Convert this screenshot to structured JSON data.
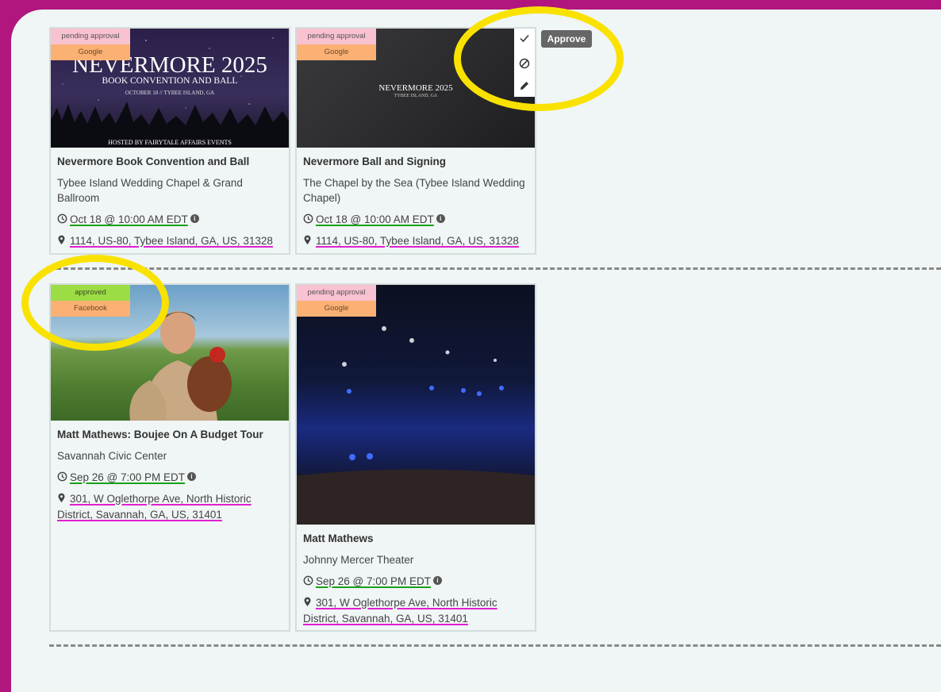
{
  "cards": [
    {
      "status": "pending approval",
      "source": "Google",
      "poster": {
        "heading": "NEVERMORE 2025",
        "subheading": "BOOK CONVENTION AND BALL",
        "dateline": "OCTOBER 18 // TYBEE ISLAND, GA",
        "footer": "HOSTED BY FAIRYTALE AFFAIRS EVENTS"
      },
      "title": "Nevermore Book Convention and Ball",
      "venue": "Tybee Island Wedding Chapel & Grand Ballroom",
      "date": "Oct 18 @ 10:00 AM EDT",
      "address": "1114, US-80, Tybee Island, GA, US, 31328"
    },
    {
      "status": "pending approval",
      "source": "Google",
      "poster": {
        "heading": "NEVERMORE 2025",
        "dateline": "TYBEE ISLAND, GA"
      },
      "title": "Nevermore Ball and Signing",
      "venue": "The Chapel by the Sea (Tybee Island Wedding Chapel)",
      "date": "Oct 18 @ 10:00 AM EDT",
      "address": "1114, US-80, Tybee Island, GA, US, 31328"
    },
    {
      "status": "approved",
      "source": "Facebook",
      "title": "Matt Mathews: Boujee On A Budget Tour",
      "venue": "Savannah Civic Center",
      "date": "Sep 26 @ 7:00 PM EDT",
      "address": "301, W Oglethorpe Ave, North Historic District, Savannah, GA, US, 31401"
    },
    {
      "status": "pending approval",
      "source": "Google",
      "title": "Matt Mathews",
      "venue": "Johnny Mercer Theater",
      "date": "Sep 26 @ 7:00 PM EDT",
      "address": "301, W Oglethorpe Ave, North Historic District, Savannah, GA, US, 31401"
    }
  ],
  "toolbar": {
    "tooltip": "Approve",
    "icons": [
      "check-icon",
      "ban-icon",
      "pencil-icon"
    ]
  },
  "icons": {
    "date": "clock-icon",
    "address": "map-pin-icon",
    "info": "info-icon"
  },
  "colors": {
    "background": "#b0167e",
    "pending": "#f9c2d0",
    "approved": "#9cdc45",
    "source": "#fbb074",
    "highlight": "#f9e200",
    "date_underline": "#18a018",
    "address_underline": "#e020d0"
  }
}
